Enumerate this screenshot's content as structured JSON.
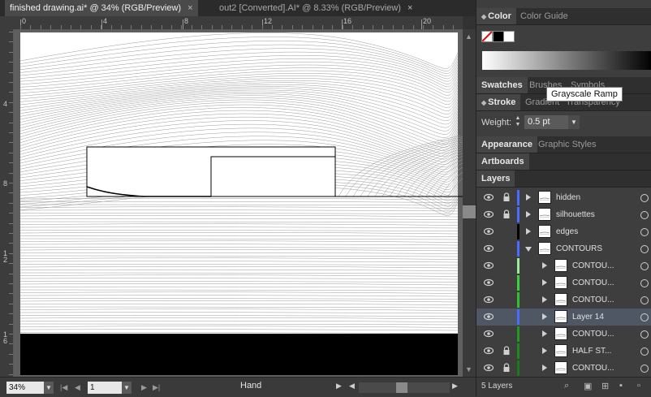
{
  "tabs": [
    {
      "label": "finished drawing.ai* @ 34% (RGB/Preview)",
      "active": true
    },
    {
      "label": "out2 [Converted].AI* @ 8.33% (RGB/Preview)",
      "active": false
    }
  ],
  "ruler": {
    "h_ticks": [
      "0",
      "4",
      "8",
      "12",
      "16",
      "20"
    ],
    "v_ticks": [
      "4",
      "8",
      "12",
      "16"
    ]
  },
  "status": {
    "zoom": "34%",
    "artboard": "1",
    "tool": "Hand"
  },
  "panels": {
    "color_group": {
      "tabs": [
        "Color",
        "Color Guide"
      ]
    },
    "swatches_group": {
      "tabs": [
        "Swatches",
        "Brushes",
        "Symbols"
      ]
    },
    "tooltip": "Grayscale Ramp",
    "stroke_group": {
      "tabs": [
        "Stroke",
        "Gradient",
        "Transparency"
      ]
    },
    "stroke": {
      "weight_label": "Weight:",
      "weight_value": "0.5 pt"
    },
    "appearance_group": {
      "tabs": [
        "Appearance",
        "Graphic Styles"
      ]
    },
    "artboards_tab": "Artboards",
    "layers_tab": "Layers",
    "layers_count": "5 Layers"
  },
  "layers": [
    {
      "name": "hidden",
      "locked": true,
      "expanded": false,
      "sublayer": false,
      "color": "#4a6bff",
      "selected": false
    },
    {
      "name": "silhouettes",
      "locked": true,
      "expanded": false,
      "sublayer": false,
      "color": "#4a6bff",
      "selected": false
    },
    {
      "name": "edges",
      "locked": false,
      "expanded": false,
      "sublayer": false,
      "color": "#000000",
      "selected": false
    },
    {
      "name": "CONTOURS",
      "locked": false,
      "expanded": true,
      "sublayer": false,
      "color": "#4a6bff",
      "selected": false
    },
    {
      "name": "CONTOU...",
      "locked": false,
      "expanded": false,
      "sublayer": true,
      "color": "#9ee89e",
      "selected": false
    },
    {
      "name": "CONTOU...",
      "locked": false,
      "expanded": false,
      "sublayer": true,
      "color": "#3ad13a",
      "selected": false
    },
    {
      "name": "CONTOU...",
      "locked": false,
      "expanded": false,
      "sublayer": true,
      "color": "#2ec22e",
      "selected": false
    },
    {
      "name": "Layer 14",
      "locked": false,
      "expanded": false,
      "sublayer": true,
      "color": "#4a6bff",
      "selected": true
    },
    {
      "name": "CONTOU...",
      "locked": false,
      "expanded": false,
      "sublayer": true,
      "color": "#1f9a1f",
      "selected": false
    },
    {
      "name": "HALF ST...",
      "locked": true,
      "expanded": false,
      "sublayer": true,
      "color": "#1c8a1c",
      "selected": false
    },
    {
      "name": "CONTOU...",
      "locked": true,
      "expanded": false,
      "sublayer": true,
      "color": "#1a7a1a",
      "selected": false
    }
  ],
  "colors": {
    "panel_bg": "#3e3e3e",
    "canvas_bg": "#5f5f5f",
    "selected_row": "#4f5764"
  }
}
